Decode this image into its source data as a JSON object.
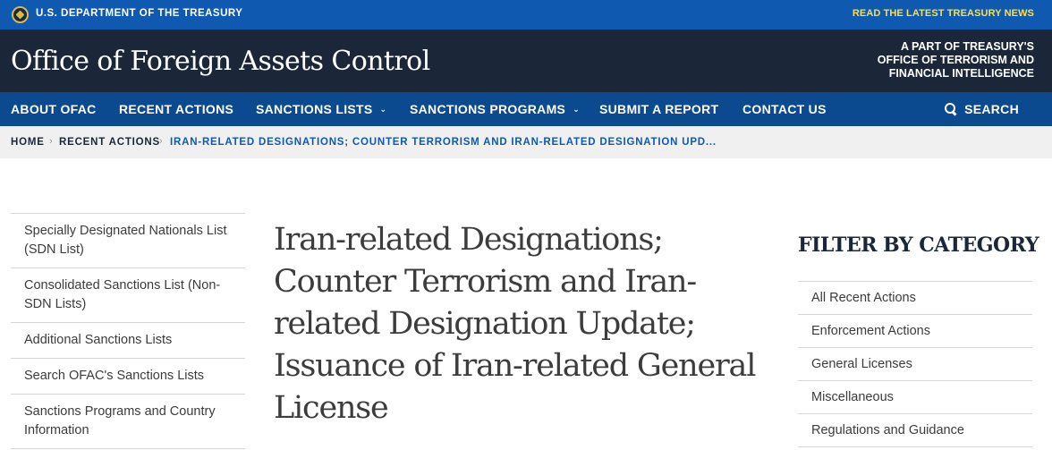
{
  "topbar": {
    "department": "U.S. DEPARTMENT OF THE TREASURY",
    "news_link": "READ THE LATEST TREASURY NEWS"
  },
  "header": {
    "title": "Office of Foreign Assets Control",
    "part_of": [
      "A PART OF TREASURY'S",
      "OFFICE OF TERRORISM AND",
      "FINANCIAL INTELLIGENCE"
    ]
  },
  "nav": {
    "items": [
      {
        "label": "ABOUT OFAC"
      },
      {
        "label": "RECENT ACTIONS"
      },
      {
        "label": "SANCTIONS LISTS"
      },
      {
        "label": "SANCTIONS PROGRAMS"
      },
      {
        "label": "SUBMIT A REPORT"
      },
      {
        "label": "CONTACT US"
      }
    ],
    "search_label": "SEARCH"
  },
  "breadcrumb": {
    "home": "HOME",
    "recent": "RECENT ACTIONS",
    "current": "IRAN-RELATED DESIGNATIONS; COUNTER TERRORISM AND IRAN-RELATED DESIGNATION UPD..."
  },
  "sidebar": {
    "items": [
      "Specially Designated Nationals List (SDN List)",
      "Consolidated Sanctions List (Non-SDN Lists)",
      "Additional Sanctions Lists",
      "Search OFAC's Sanctions Lists",
      "Sanctions Programs and Country Information"
    ]
  },
  "main": {
    "title": "Iran-related Designations; Counter Terrorism and Iran-related Designation Update; Issuance of Iran-related General License"
  },
  "filter": {
    "heading": "FILTER BY CATEGORY",
    "items": [
      "All Recent Actions",
      "Enforcement Actions",
      "General Licenses",
      "Miscellaneous",
      "Regulations and Guidance"
    ]
  },
  "colors": {
    "topbar": "#0f5ab0",
    "header": "#1b2738",
    "nav": "#0c4a8f",
    "news_link": "#f7e04b"
  }
}
